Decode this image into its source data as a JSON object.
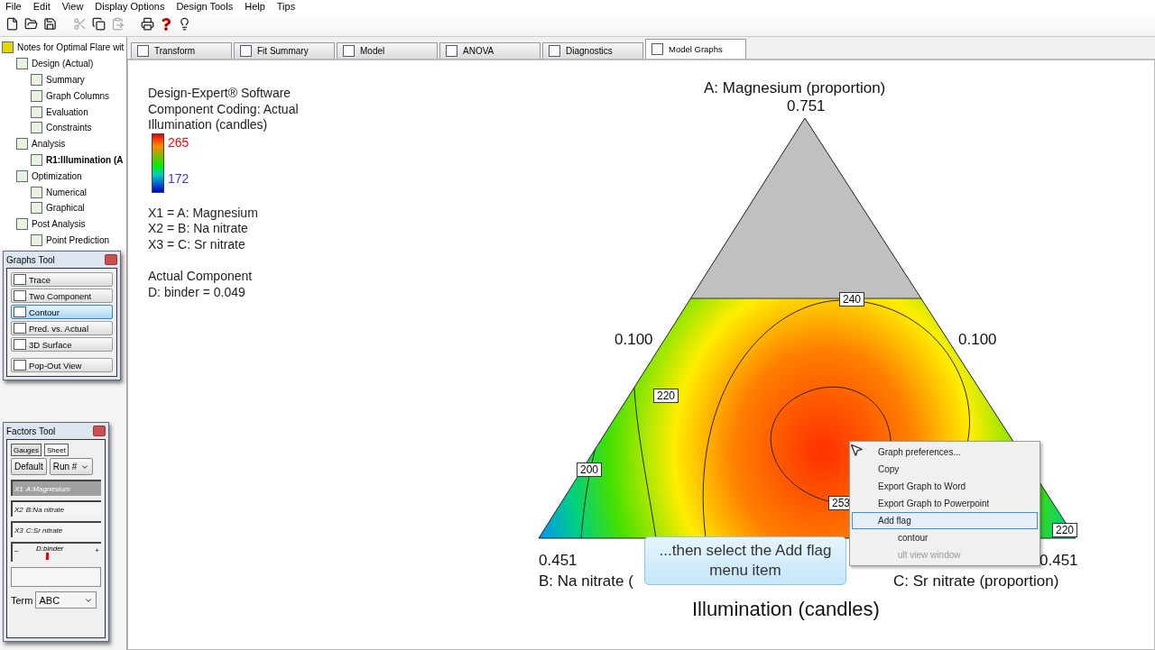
{
  "menu_bar": [
    "File",
    "Edit",
    "View",
    "Display Options",
    "Design Tools",
    "Help",
    "Tips"
  ],
  "toolbar": [
    {
      "kind": "new",
      "disabled": false
    },
    {
      "kind": "open",
      "disabled": false
    },
    {
      "kind": "save",
      "disabled": false
    },
    {
      "kind": "cut",
      "disabled": true
    },
    {
      "kind": "copy",
      "disabled": false
    },
    {
      "kind": "paste",
      "disabled": true
    },
    {
      "kind": "print",
      "disabled": false
    },
    {
      "kind": "help",
      "disabled": false
    },
    {
      "kind": "tip",
      "disabled": false
    }
  ],
  "tree": {
    "label": "Notes for Optimal Flare wit",
    "children": [
      {
        "label": "Design (Actual)",
        "selected": false,
        "children": [
          {
            "label": "Summary",
            "selected": false
          },
          {
            "label": "Graph Columns",
            "selected": false
          },
          {
            "label": "Evaluation",
            "selected": false
          },
          {
            "label": "Constraints",
            "selected": false
          }
        ]
      },
      {
        "label": "Analysis",
        "selected": false,
        "children": [
          {
            "label": "R1:Illumination (A",
            "selected": true
          }
        ]
      },
      {
        "label": "Optimization",
        "selected": false,
        "children": [
          {
            "label": "Numerical",
            "selected": false
          },
          {
            "label": "Graphical",
            "selected": false
          }
        ]
      },
      {
        "label": "Post Analysis",
        "selected": false,
        "children": [
          {
            "label": "Point Prediction",
            "selected": false
          }
        ]
      }
    ]
  },
  "graphs_tool": {
    "title": "Graphs Tool",
    "buttons": [
      {
        "label": "Trace",
        "selected": false
      },
      {
        "label": "Two Component",
        "selected": false
      },
      {
        "label": "Contour",
        "selected": true
      },
      {
        "label": "Pred. vs. Actual",
        "selected": false
      },
      {
        "label": "3D Surface",
        "selected": false
      },
      {
        "label": "Pop-Out View",
        "selected": false
      }
    ]
  },
  "factors_tool": {
    "title": "Factors Tool",
    "tabs": [
      {
        "label": "Gauges",
        "selected": true
      },
      {
        "label": "Sheet",
        "selected": false
      }
    ],
    "default_button": "Default",
    "run_dropdown": "Run #",
    "factors": [
      {
        "code": "X1",
        "name": "A:Magnesium",
        "selected": true
      },
      {
        "code": "X2",
        "name": "B:Na nitrate",
        "selected": false
      },
      {
        "code": "X3",
        "name": "C:Sr nitrate",
        "selected": false
      }
    ],
    "slider": {
      "minus": "–",
      "plus": "+",
      "label": "D:binder",
      "level": 0.42
    },
    "term_label": "Term",
    "term_value": "ABC"
  },
  "tabs": [
    {
      "label": "Transform",
      "selected": false
    },
    {
      "label": "Fit Summary",
      "selected": false
    },
    {
      "label": "Model",
      "selected": false
    },
    {
      "label": "ANOVA",
      "selected": false
    },
    {
      "label": "Diagnostics",
      "selected": false
    },
    {
      "label": "Model Graphs",
      "selected": true
    }
  ],
  "graph": {
    "info": [
      "Design-Expert® Software",
      "Component Coding: Actual",
      "Illumination (candles)"
    ],
    "scale_high": "265",
    "scale_low": "172",
    "variables": [
      "X1 = A: Magnesium",
      "X2 = B: Na nitrate",
      "X3 = C: Sr nitrate"
    ],
    "actual": [
      "Actual Component",
      "D: binder = 0.049"
    ],
    "top_axis": "A: Magnesium (proportion)",
    "top_value": "0.751",
    "left_value": "0.100",
    "right_value": "0.100",
    "bottom_left_value": "0.451",
    "bottom_right_value": "0.451",
    "bottom_left_axis": "B: Na nitrate (",
    "bottom_right_axis": "C: Sr nitrate (proportion)",
    "title": "Illumination (candles)",
    "contour_labels": [
      "240",
      "220",
      "200",
      "253",
      "220"
    ]
  },
  "context_menu": [
    {
      "label": "Graph preferences...",
      "selected": false,
      "disabled": false
    },
    {
      "label": "Copy",
      "selected": false,
      "disabled": false
    },
    {
      "label": "Export Graph to Word",
      "selected": false,
      "disabled": false
    },
    {
      "label": "Export Graph to Powerpoint",
      "selected": false,
      "disabled": false
    },
    {
      "label": "Add flag",
      "selected": true,
      "disabled": false
    },
    {
      "label": "contour",
      "selected": false,
      "disabled": false
    },
    {
      "label": "ult view window",
      "selected": false,
      "disabled": true
    }
  ],
  "callout": "...then select the Add flag menu item"
}
